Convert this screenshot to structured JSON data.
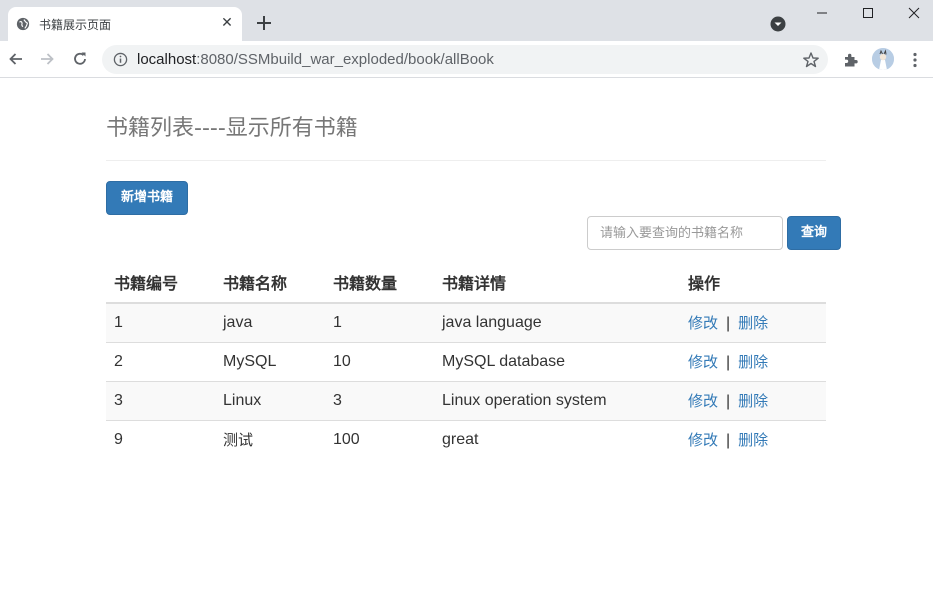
{
  "browser": {
    "tab_title": "书籍展示页面",
    "url_host": "localhost",
    "url_rest": ":8080/SSMbuild_war_exploded/book/allBook"
  },
  "page": {
    "title": "书籍列表----显示所有书籍",
    "add_button": "新增书籍",
    "search_placeholder": "请输入要查询的书籍名称",
    "query_button": "查询"
  },
  "table": {
    "headers": [
      "书籍编号",
      "书籍名称",
      "书籍数量",
      "书籍详情",
      "操作"
    ],
    "rows": [
      [
        "1",
        "java",
        "1",
        "java language"
      ],
      [
        "2",
        "MySQL",
        "10",
        "MySQL database"
      ],
      [
        "3",
        "Linux",
        "3",
        "Linux operation system"
      ],
      [
        "9",
        "测试",
        "100",
        "great"
      ]
    ],
    "edit_label": "修改",
    "separator": "|",
    "delete_label": "删除"
  },
  "colors": {
    "primary": "#337ab7",
    "link": "#337ab7",
    "title_gray": "#777777"
  }
}
